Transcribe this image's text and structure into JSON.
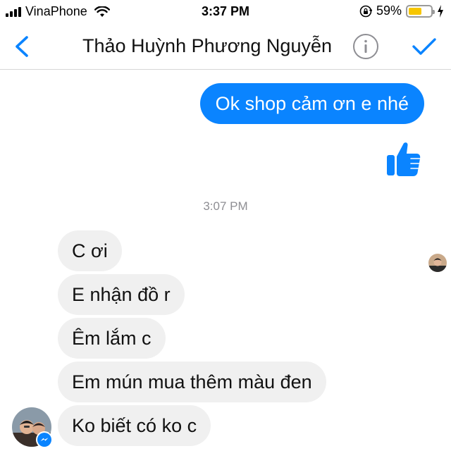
{
  "status_bar": {
    "carrier": "VinaPhone",
    "time": "3:37 PM",
    "battery_percent": "59%",
    "battery_level": 0.59,
    "icons": [
      "signal-icon",
      "wifi-icon",
      "orientation-lock-icon",
      "battery-icon",
      "charging-bolt-icon"
    ]
  },
  "nav_bar": {
    "title": "Thảo Huỳnh Phương Nguyễn",
    "icons": [
      "back-chevron-icon",
      "info-icon",
      "checkmark-icon"
    ]
  },
  "conversation": {
    "outgoing": [
      {
        "text": "Ok shop cảm ơn e nhé"
      }
    ],
    "outgoing_reaction_icon": "thumbs-up-icon",
    "timestamp": "3:07 PM",
    "incoming": [
      {
        "text": "C ơi"
      },
      {
        "text": "E nhận đồ r"
      },
      {
        "text": "Êm lắm c"
      },
      {
        "text": "Em mún mua thêm màu đen"
      },
      {
        "text": "Ko biết có ko c"
      }
    ]
  },
  "colors": {
    "accent": "#0a84ff",
    "incoming_bubble": "#f0f0f0",
    "battery": "#f7c600",
    "timestamp": "#8e8e93"
  }
}
